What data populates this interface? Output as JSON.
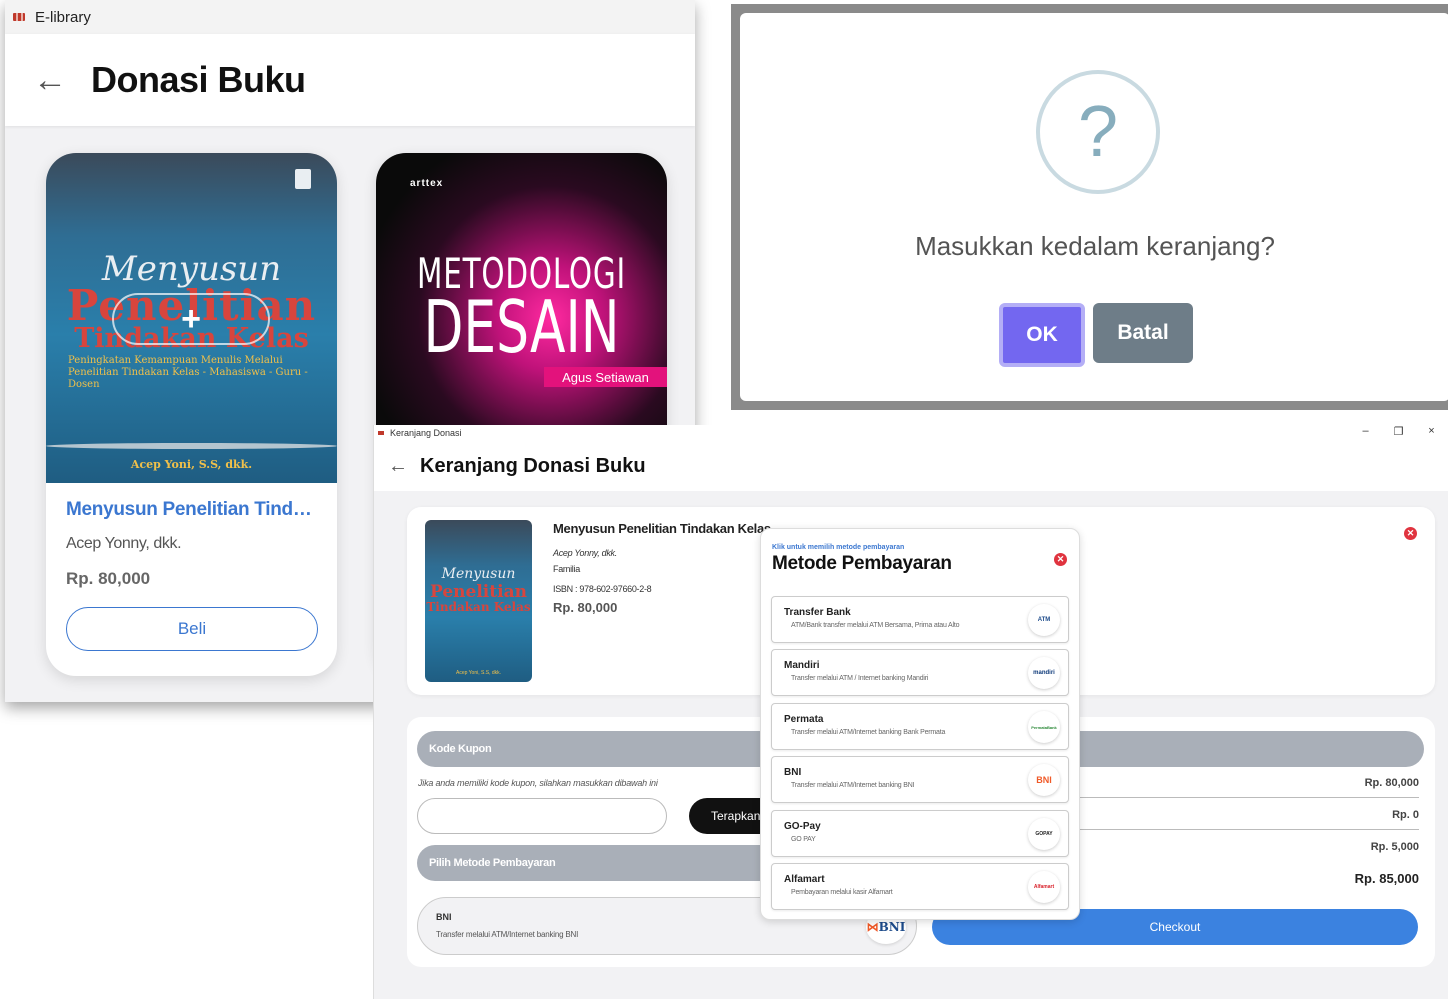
{
  "library_window": {
    "title": "E-library",
    "header": "Donasi Buku",
    "books": [
      {
        "title": "Menyusun Penelitian Tindak...",
        "author": "Acep Yonny, dkk.",
        "price": "Rp. 80,000",
        "button": "Beli",
        "cover": {
          "line1": "Menyusun",
          "line2": "Penelitian",
          "line3": "Tindakan Kelas",
          "subtitle": "Peningkatan Kemampuan Menulis Melalui Penelitian Tindakan Kelas - Mahasiswa - Guru - Dosen",
          "author": "Acep Yoni, S.S, dkk."
        }
      },
      {
        "cover": {
          "brand": "arttex",
          "line1": "METODOLOGI",
          "line2": "DESAIN",
          "author": "Agus Setiawan"
        }
      }
    ]
  },
  "confirm_dialog": {
    "icon": "?",
    "message": "Masukkan kedalam keranjang?",
    "ok_label": "OK",
    "cancel_label": "Batal",
    "ok_color": "#7367f0",
    "cancel_color": "#6e7d88"
  },
  "cart_window": {
    "title": "Keranjang Donasi",
    "header": "Keranjang Donasi Buku",
    "window_controls": [
      "–",
      "❐",
      "×"
    ],
    "item": {
      "title": "Menyusun Penelitian Tindakan Kelas",
      "author": "Acep Yonny, dkk.",
      "publisher": "Familia",
      "isbn": "ISBN : 978-602-97660-2-8",
      "price": "Rp. 80,000",
      "thumb": {
        "line1": "Menyusun",
        "line2": "Penelitian",
        "line3": "Tindakan Kelas",
        "author": "Acep Yoni, S.S, dkk."
      }
    },
    "coupon": {
      "section_label": "Kode Kupon",
      "hint": "Jika anda memiliki kode kupon, silahkan masukkan dibawah ini",
      "input_value": "",
      "apply_label": "Terapkan"
    },
    "payment_section": {
      "section_label": "Pilih Metode Pembayaran",
      "selected_name": "BNI",
      "selected_desc": "Transfer melalui ATM/Internet banking BNI",
      "selected_logo": "BNI"
    },
    "summary": [
      "Rp. 80,000",
      "Rp. 0",
      "Rp. 5,000",
      "Rp. 85,000"
    ],
    "checkout_label": "Checkout"
  },
  "payment_modal": {
    "caption": "Klik untuk memilih metode pembayaran",
    "title": "Metode Pembayaran",
    "options": [
      {
        "name": "Transfer Bank",
        "desc": "ATM/Bank transfer melalui ATM Bersama, Prima atau Alto",
        "logo": "ATM"
      },
      {
        "name": "Mandiri",
        "desc": "Transfer melalui ATM / Internet banking Mandiri",
        "logo": "mandiri"
      },
      {
        "name": "Permata",
        "desc": "Transfer melalui ATM/Internet banking Bank Permata",
        "logo": "PermataBank"
      },
      {
        "name": "BNI",
        "desc": "Transfer melalui ATM/Internet banking BNI",
        "logo": "BNI"
      },
      {
        "name": "GO-Pay",
        "desc": "GO PAY",
        "logo": "GOPAY"
      },
      {
        "name": "Alfamart",
        "desc": "Pembayaran melalui kasir Alfamart",
        "logo": "Alfamart"
      }
    ]
  }
}
